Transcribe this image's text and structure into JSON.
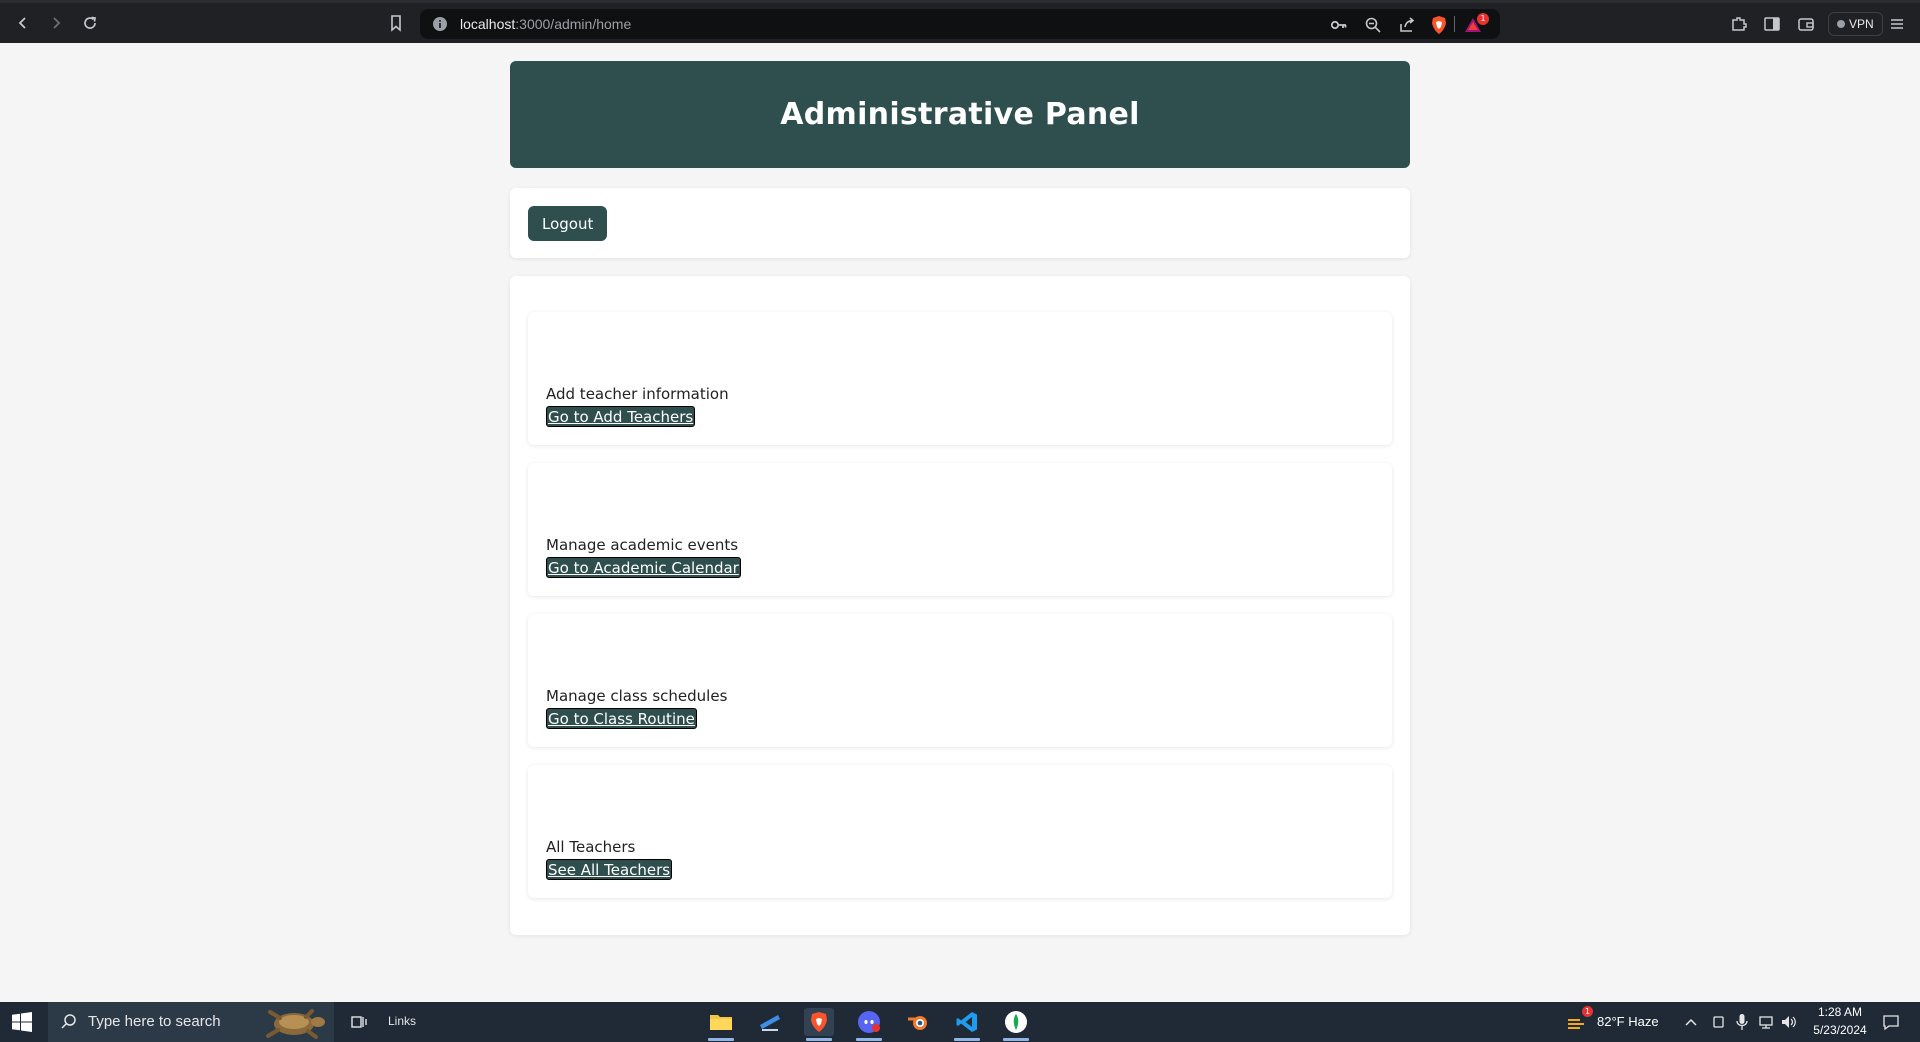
{
  "browser": {
    "url_host": "localhost",
    "url_path": ":3000/admin/home",
    "vpn_label": "VPN",
    "notification_count": "1"
  },
  "page": {
    "title": "Administrative Panel",
    "logout_label": "Logout",
    "features": [
      {
        "description": "Add teacher information",
        "button": "Go to Add Teachers"
      },
      {
        "description": "Manage academic events",
        "button": "Go to Academic Calendar"
      },
      {
        "description": "Manage class schedules",
        "button": "Go to Class Routine"
      },
      {
        "description": "All Teachers",
        "button": "See All Teachers"
      }
    ]
  },
  "taskbar": {
    "search_placeholder": "Type here to search",
    "links_label": "Links",
    "weather": "82°F  Haze",
    "weather_badge": "1",
    "time": "1:28 AM",
    "date": "5/23/2024"
  },
  "colors": {
    "brand": "#2f4f4f",
    "chrome": "#202124",
    "taskbar": "#1f2a36"
  }
}
